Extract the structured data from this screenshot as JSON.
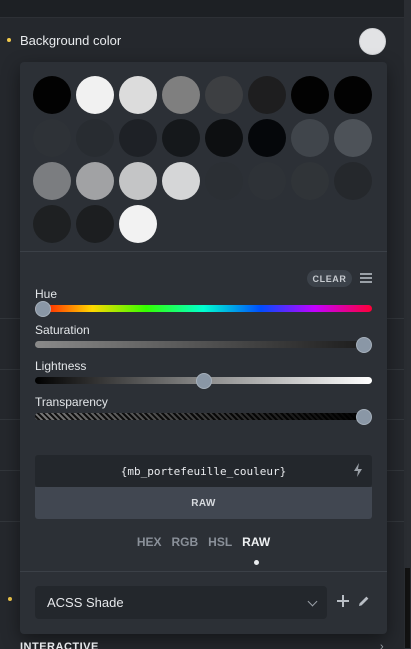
{
  "field": {
    "label": "Background color",
    "swatch_color": "#e2e3e5"
  },
  "palette": [
    [
      "#020202",
      "#f1f1f1",
      "#dcdcdc",
      "#7f7f7f",
      "#3d3f42",
      "#1e1e1f",
      "#020202",
      "#020202"
    ],
    [
      "#2e3237",
      "#282c31",
      "#1e2126",
      "#15181b",
      "#0d0f11",
      "#05070a",
      "#40454b",
      "#4d5258"
    ],
    [
      "#7b7d80",
      "#a1a2a4",
      "#c4c5c6",
      "#d5d6d7",
      "#2b2f34",
      "#2e3237",
      "#303438",
      "#25282c"
    ],
    [
      "#1e2022",
      "#1c1e20",
      "#f2f2f2"
    ]
  ],
  "toolbar": {
    "clear_label": "CLEAR",
    "menu_icon": "menu-icon"
  },
  "sliders": {
    "hue": {
      "label": "Hue",
      "value": 0.0
    },
    "saturation": {
      "label": "Saturation",
      "value": 1.0
    },
    "lightness": {
      "label": "Lightness",
      "value": 0.5
    },
    "transparency": {
      "label": "Transparency",
      "value": 1.0
    }
  },
  "variable": {
    "value": "{mb_portefeuille_couleur}",
    "icon": "bolt-icon"
  },
  "mode_bar": {
    "label": "RAW"
  },
  "formats": {
    "items": [
      "HEX",
      "RGB",
      "HSL",
      "RAW"
    ],
    "active": "RAW"
  },
  "shade_select": {
    "value": "ACSS Shade"
  },
  "section": {
    "label": "INTERACTIVE"
  }
}
